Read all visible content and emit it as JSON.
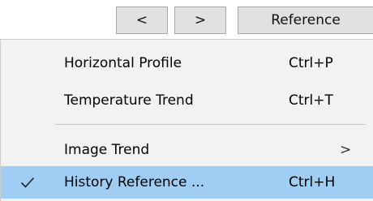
{
  "toolbar": {
    "prev_label": "<",
    "next_label": ">",
    "reference_label": "Reference"
  },
  "menu": {
    "items": [
      {
        "label": "Horizontal Profile",
        "shortcut": "Ctrl+P"
      },
      {
        "label": "Temperature Trend",
        "shortcut": "Ctrl+T"
      },
      {
        "label": "Image Trend",
        "submenu_arrow": ">"
      },
      {
        "label": "History Reference ...",
        "shortcut": "Ctrl+H",
        "checked": true,
        "highlighted": true
      }
    ],
    "check_icon": "check-icon",
    "highlight_color": "#9fcdf4",
    "background_color": "#f2f2f2"
  }
}
